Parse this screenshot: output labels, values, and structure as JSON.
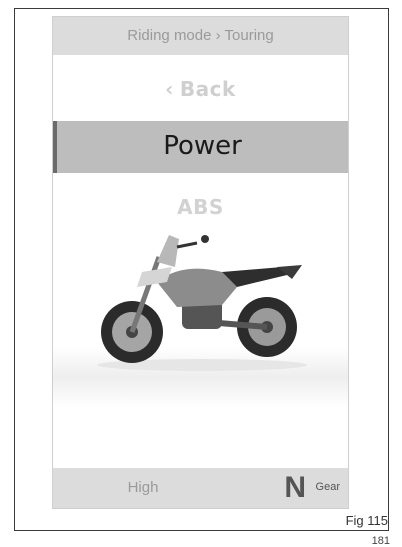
{
  "header": {
    "title": "Riding mode › Touring"
  },
  "menu": {
    "back_label": "Back",
    "back_icon": "chevron-left-icon",
    "selected": "Power",
    "next": "ABS"
  },
  "footer": {
    "value": "High",
    "gear": "N",
    "gear_label": "Gear"
  },
  "figure": {
    "caption": "Fig 115",
    "page": "181"
  },
  "colors": {
    "highlight": "#bdbdbd",
    "header_bg": "#dcdcdc",
    "dim_text": "#cfcfcf"
  }
}
